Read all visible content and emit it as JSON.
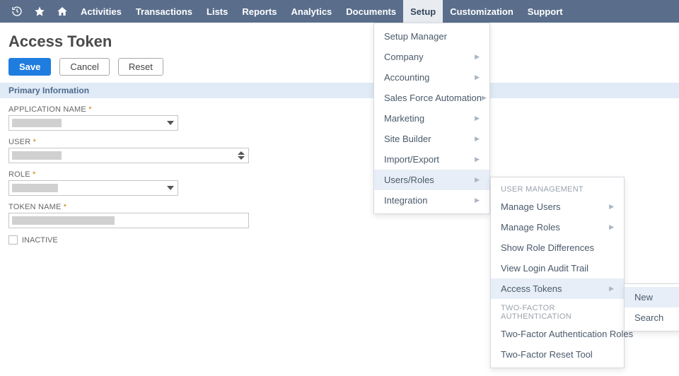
{
  "nav": {
    "items": [
      {
        "label": "Activities"
      },
      {
        "label": "Transactions"
      },
      {
        "label": "Lists"
      },
      {
        "label": "Reports"
      },
      {
        "label": "Analytics"
      },
      {
        "label": "Documents"
      },
      {
        "label": "Setup",
        "active": true
      },
      {
        "label": "Customization"
      },
      {
        "label": "Support"
      }
    ]
  },
  "page": {
    "title": "Access Token",
    "save": "Save",
    "cancel": "Cancel",
    "reset": "Reset",
    "section": "Primary Information"
  },
  "fields": {
    "app_name": "APPLICATION NAME",
    "user": "USER",
    "role": "ROLE",
    "token_name": "TOKEN NAME",
    "inactive": "INACTIVE",
    "required": "*"
  },
  "menu1": {
    "setup_manager": "Setup Manager",
    "company": "Company",
    "accounting": "Accounting",
    "sfa": "Sales Force Automation",
    "marketing": "Marketing",
    "site_builder": "Site Builder",
    "import_export": "Import/Export",
    "users_roles": "Users/Roles",
    "integration": "Integration"
  },
  "menu2": {
    "header_um": "USER MANAGEMENT",
    "manage_users": "Manage Users",
    "manage_roles": "Manage Roles",
    "show_diff": "Show Role Differences",
    "audit_trail": "View Login Audit Trail",
    "access_tokens": "Access Tokens",
    "header_2fa": "TWO-FACTOR AUTHENTICATION",
    "tfa_roles": "Two-Factor Authentication Roles",
    "tfa_reset": "Two-Factor Reset Tool"
  },
  "menu3": {
    "new": "New",
    "search": "Search"
  }
}
